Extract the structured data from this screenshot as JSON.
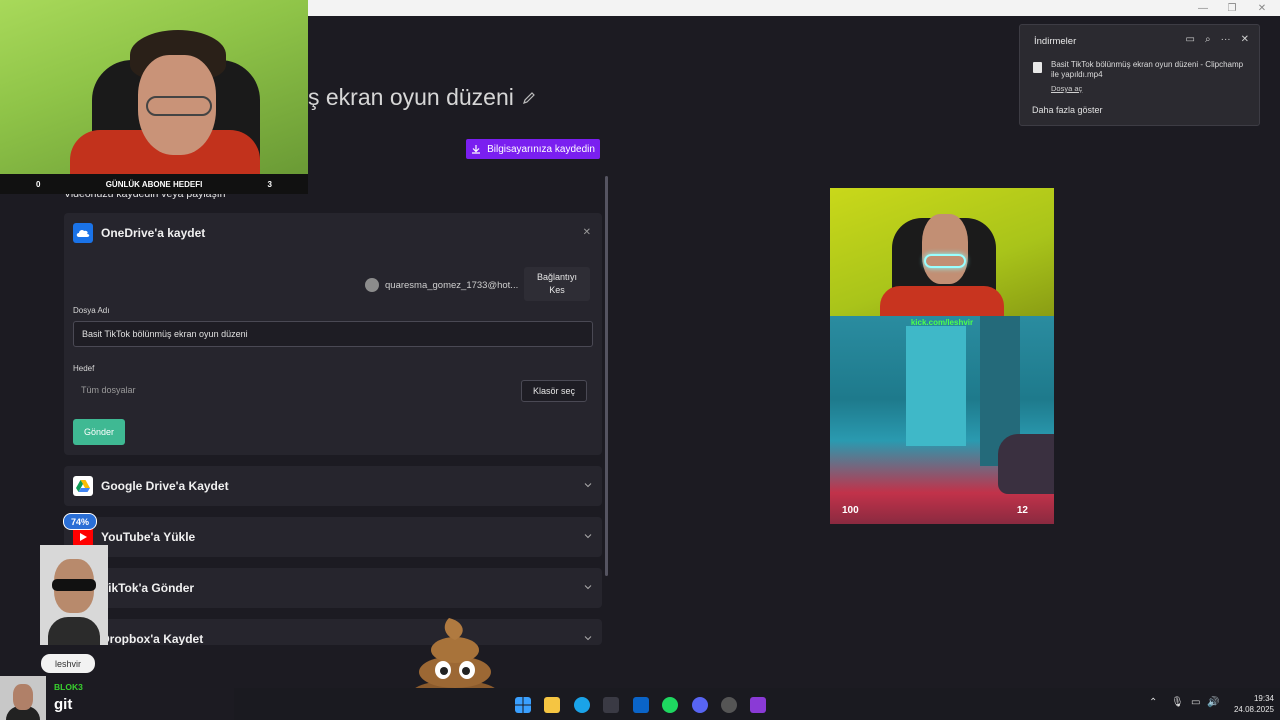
{
  "page": {
    "title": "ş ekran oyun düzeni",
    "save_button": "Bilgisayarınıza kaydedin",
    "subtitle": "Videonuzu kaydedin veya paylaşın"
  },
  "onedrive": {
    "title": "OneDrive'a kaydet",
    "account": "quaresma_gomez_1733@hot...",
    "disconnect_line1": "Bağlantıyı",
    "disconnect_line2": "Kes",
    "filename_label": "Dosya Adı",
    "filename_value": "Basit TikTok bölünmüş ekran oyun düzeni",
    "target_label": "Hedef",
    "target_value": "Tüm dosyalar",
    "folder_button": "Klasör seç",
    "send_button": "Gönder"
  },
  "sections": [
    {
      "title": "Google Drive'a Kaydet"
    },
    {
      "title": "YouTube'a Yükle"
    },
    {
      "title": "TikTok'a Gönder"
    },
    {
      "title": "Dropbox'a Kaydet"
    }
  ],
  "downloads": {
    "title": "İndirmeler",
    "file_name": "Basit TikTok bölünmüş ekran oyun düzeni - Clipchamp ile yapıldı.mp4",
    "open_file": "Dosya aç",
    "show_more": "Daha fazla göster"
  },
  "stream": {
    "goal_left": "0",
    "goal_title": "GÜNLÜK ABONE HEDEFI",
    "goal_right": "3",
    "badge": "74%",
    "nick": "leshvir",
    "chat_user": "BLOK3",
    "chat_message": "git"
  },
  "preview": {
    "kick_text": "kick.com/leshvir",
    "hp": "100",
    "ammo": "12"
  },
  "taskbar": {
    "time": "19:34",
    "date": "24.08.2025"
  },
  "colors": {
    "accent": "#7a1ff0",
    "send": "#3fb993",
    "background": "#1c1b22",
    "card": "#26252d"
  }
}
